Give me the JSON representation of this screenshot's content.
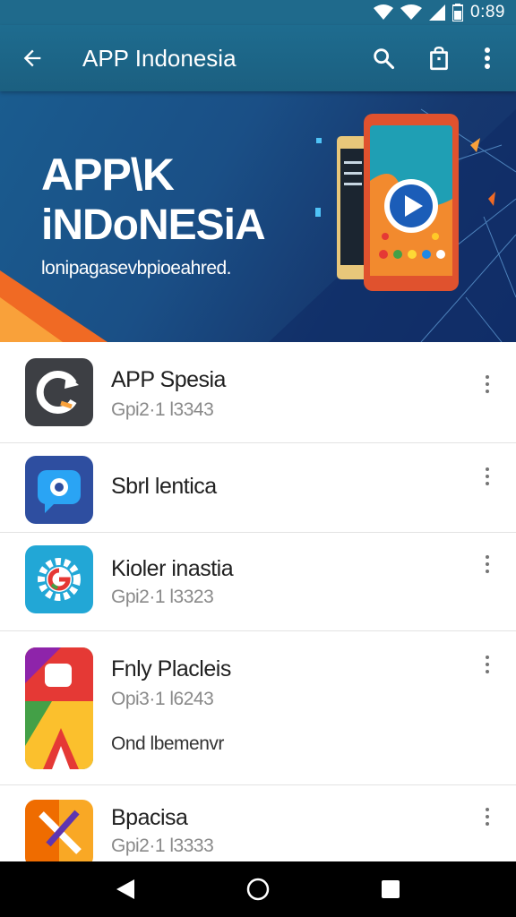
{
  "status_bar": {
    "time": "0:89",
    "icons": [
      "wifi-icon",
      "wifi-icon",
      "signal-icon",
      "battery-icon"
    ]
  },
  "app_bar": {
    "title": "APP Indonesia",
    "back_icon": "back-arrow-icon",
    "actions": [
      "search-icon",
      "bag-icon",
      "more-vert-icon"
    ]
  },
  "banner": {
    "title_line1": "APP\\K",
    "title_line2": "iNDoNESiA",
    "subtitle": "lonipagasevbpioeahred."
  },
  "apps": [
    {
      "name": "APP Spesia",
      "meta": "Gpi2·1 l3343",
      "extra": ""
    },
    {
      "name": "Sbrl lentica",
      "meta": "",
      "extra": ""
    },
    {
      "name": "Kioler inastia",
      "meta": "Gpi2·1 l3323",
      "extra": ""
    },
    {
      "name": "Fnly Placleis",
      "meta": "Opi3·1 l6243",
      "extra": "Ond lbemenvr"
    },
    {
      "name": "Bpacisa",
      "meta": "Gpi2·1 l3333",
      "extra": ""
    }
  ],
  "nav_bar": {
    "buttons": [
      "back-triangle-icon",
      "home-circle-icon",
      "recents-square-icon"
    ]
  },
  "colors": {
    "app_bar": "#1e6c8f",
    "banner": "#1a4f86",
    "accent_orange": "#f06a24"
  }
}
